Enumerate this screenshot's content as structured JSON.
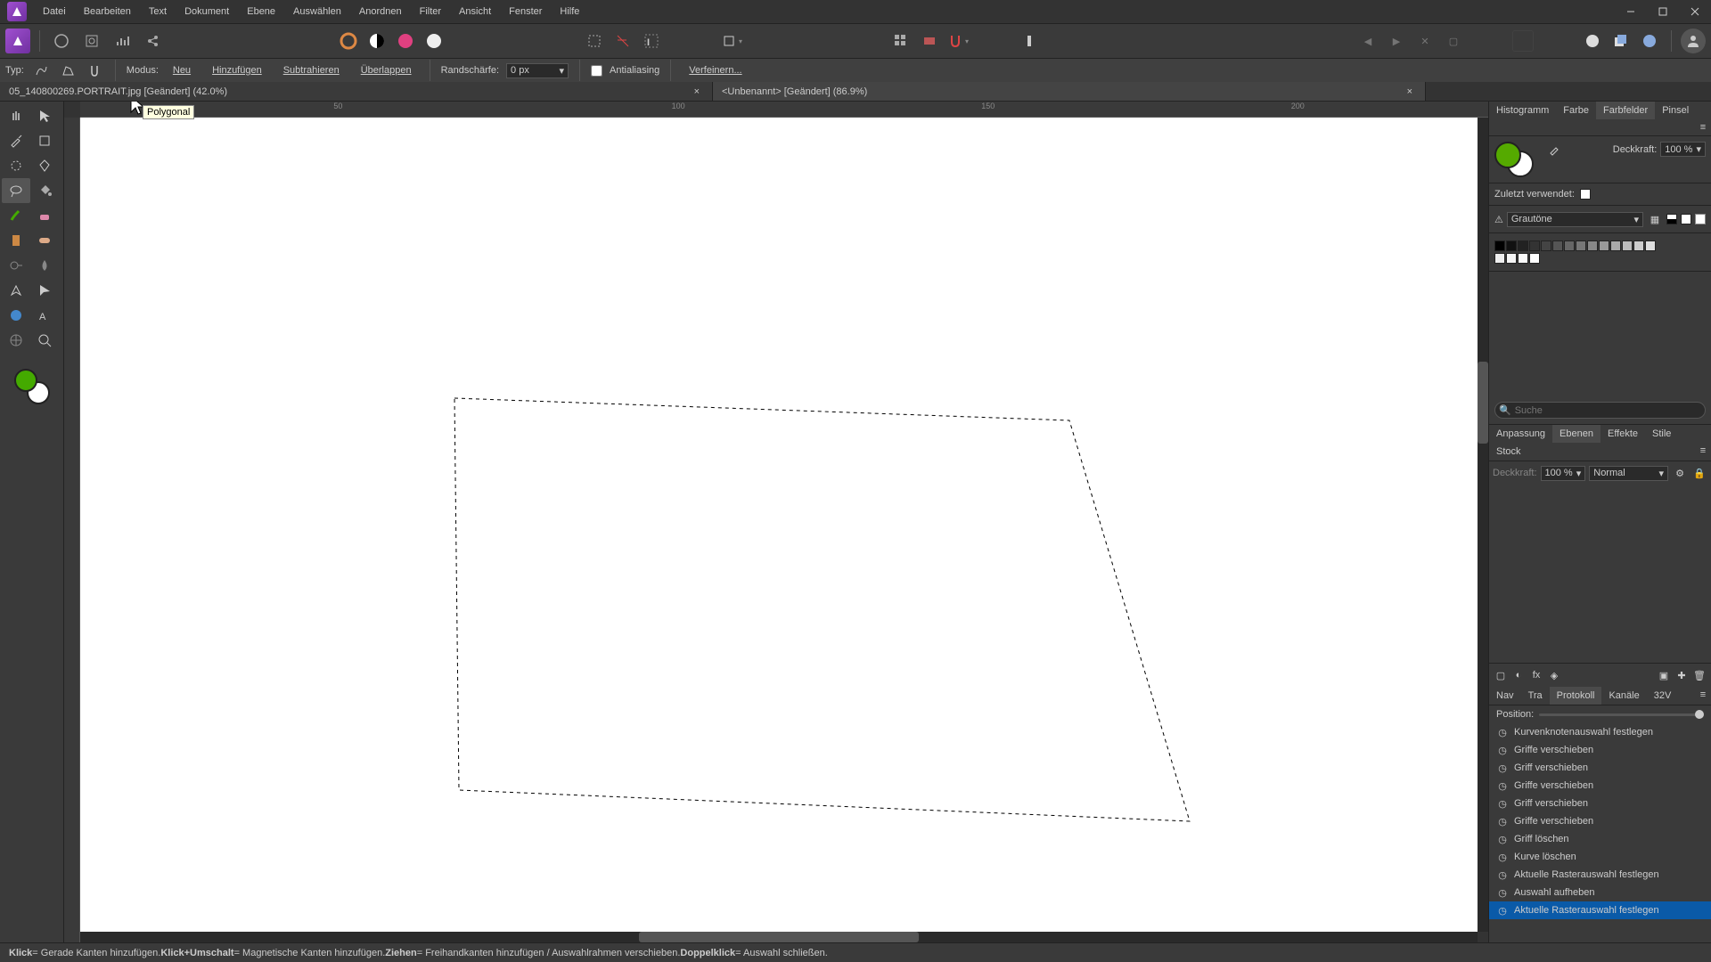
{
  "menu": [
    "Datei",
    "Bearbeiten",
    "Text",
    "Dokument",
    "Ebene",
    "Auswählen",
    "Anordnen",
    "Filter",
    "Ansicht",
    "Fenster",
    "Hilfe"
  ],
  "optbar": {
    "typ_label": "Typ:",
    "modus_label": "Modus:",
    "modes": [
      "Neu",
      "Hinzufügen",
      "Subtrahieren",
      "Überlappen"
    ],
    "rand_label": "Randschärfe:",
    "rand_value": "0 px",
    "aa_label": "Antialiasing",
    "refine": "Verfeinern..."
  },
  "tooltip": "Polygonal",
  "tabs": [
    {
      "label": "05_140800269.PORTRAIT.jpg [Geändert] (42.0%)"
    },
    {
      "label": "<Unbenannt> [Geändert] (86.9%)"
    }
  ],
  "ruler_h": [
    "50",
    "100",
    "150",
    "200"
  ],
  "right": {
    "top_tabs": [
      "Histogramm",
      "Farbe",
      "Farbfelder",
      "Pinsel"
    ],
    "deckkraft_label": "Deckkraft:",
    "deckkraft_value": "100 %",
    "recent_label": "Zuletzt verwendet:",
    "palette": "Grautöne",
    "search_placeholder": "Suche",
    "mid_tabs": [
      "Anpassung",
      "Ebenen",
      "Effekte",
      "Stile",
      "Stock"
    ],
    "opacity": "100 %",
    "blend": "Normal",
    "bottom_tabs": [
      "Nav",
      "Tra",
      "Protokoll",
      "Kanäle",
      "32V"
    ],
    "position_label": "Position:",
    "protocol": [
      "Kurvenknotenauswahl festlegen",
      "Griffe verschieben",
      "Griff verschieben",
      "Griffe verschieben",
      "Griff verschieben",
      "Griffe verschieben",
      "Griff löschen",
      "Kurve löschen",
      "Aktuelle Rasterauswahl festlegen",
      "Auswahl aufheben",
      "Aktuelle Rasterauswahl festlegen"
    ]
  },
  "status": {
    "k1": "Klick",
    "t1": " = Gerade Kanten hinzufügen. ",
    "k2": "Klick+Umschalt",
    "t2": " = Magnetische Kanten hinzufügen. ",
    "k3": "Ziehen",
    "t3": " = Freihandkanten hinzufügen / Auswahlrahmen verschieben. ",
    "k4": "Doppelklick",
    "t4": " = Auswahl schließen."
  },
  "selection_poly": "420,315 1110,340 1245,790 425,755"
}
